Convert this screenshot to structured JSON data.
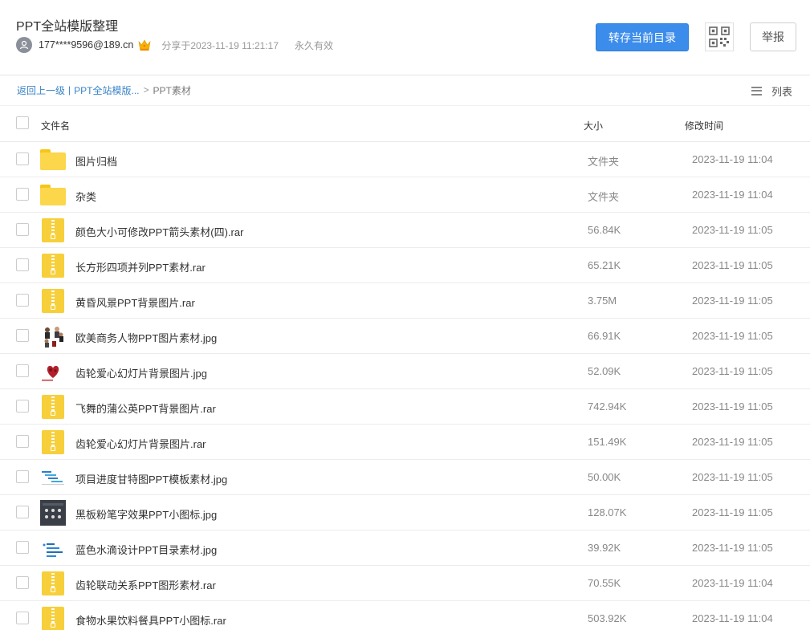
{
  "header": {
    "title": "PPT全站模版整理",
    "user": "177****9596@189.cn",
    "share_time": "分享于2023-11-19 11:21:17",
    "validity": "永久有效",
    "save_button": "转存当前目录",
    "report_button": "举报",
    "accent_color": "#3b8ceb"
  },
  "breadcrumb": {
    "back": "返回上一级",
    "separator": "|",
    "parent": "PPT全站模版...",
    "arrow": ">",
    "current": "PPT素材"
  },
  "view_toggle": {
    "label": "列表"
  },
  "table": {
    "headers": {
      "name": "文件名",
      "size": "大小",
      "time": "修改时间"
    },
    "rows": [
      {
        "icon": "folder-icon",
        "name": "图片归档",
        "size": "文件夹",
        "time": "2023-11-19 11:04"
      },
      {
        "icon": "folder-icon",
        "name": "杂类",
        "size": "文件夹",
        "time": "2023-11-19 11:04"
      },
      {
        "icon": "zip-icon",
        "name": "颜色大小可修改PPT箭头素材(四).rar",
        "size": "56.84K",
        "time": "2023-11-19 11:05"
      },
      {
        "icon": "zip-icon",
        "name": "长方形四项并列PPT素材.rar",
        "size": "65.21K",
        "time": "2023-11-19 11:05"
      },
      {
        "icon": "zip-icon",
        "name": "黄昏风景PPT背景图片.rar",
        "size": "3.75M",
        "time": "2023-11-19 11:05"
      },
      {
        "icon": "image-thumbnail-people",
        "name": "欧美商务人物PPT图片素材.jpg",
        "size": "66.91K",
        "time": "2023-11-19 11:05"
      },
      {
        "icon": "image-thumbnail-heart",
        "name": "齿轮爱心幻灯片背景图片.jpg",
        "size": "52.09K",
        "time": "2023-11-19 11:05"
      },
      {
        "icon": "zip-icon",
        "name": "飞舞的蒲公英PPT背景图片.rar",
        "size": "742.94K",
        "time": "2023-11-19 11:05"
      },
      {
        "icon": "zip-icon",
        "name": "齿轮爱心幻灯片背景图片.rar",
        "size": "151.49K",
        "time": "2023-11-19 11:05"
      },
      {
        "icon": "image-thumbnail-gantt",
        "name": "项目进度甘特图PPT模板素材.jpg",
        "size": "50.00K",
        "time": "2023-11-19 11:05"
      },
      {
        "icon": "image-thumbnail-blackboard",
        "name": "黑板粉笔字效果PPT小图标.jpg",
        "size": "128.07K",
        "time": "2023-11-19 11:05"
      },
      {
        "icon": "image-thumbnail-blue-drops",
        "name": "蓝色水滴设计PPT目录素材.jpg",
        "size": "39.92K",
        "time": "2023-11-19 11:05"
      },
      {
        "icon": "zip-icon",
        "name": "齿轮联动关系PPT图形素材.rar",
        "size": "70.55K",
        "time": "2023-11-19 11:04"
      },
      {
        "icon": "zip-icon",
        "name": "食物水果饮料餐具PPT小图标.rar",
        "size": "503.92K",
        "time": "2023-11-19 11:04"
      }
    ]
  }
}
